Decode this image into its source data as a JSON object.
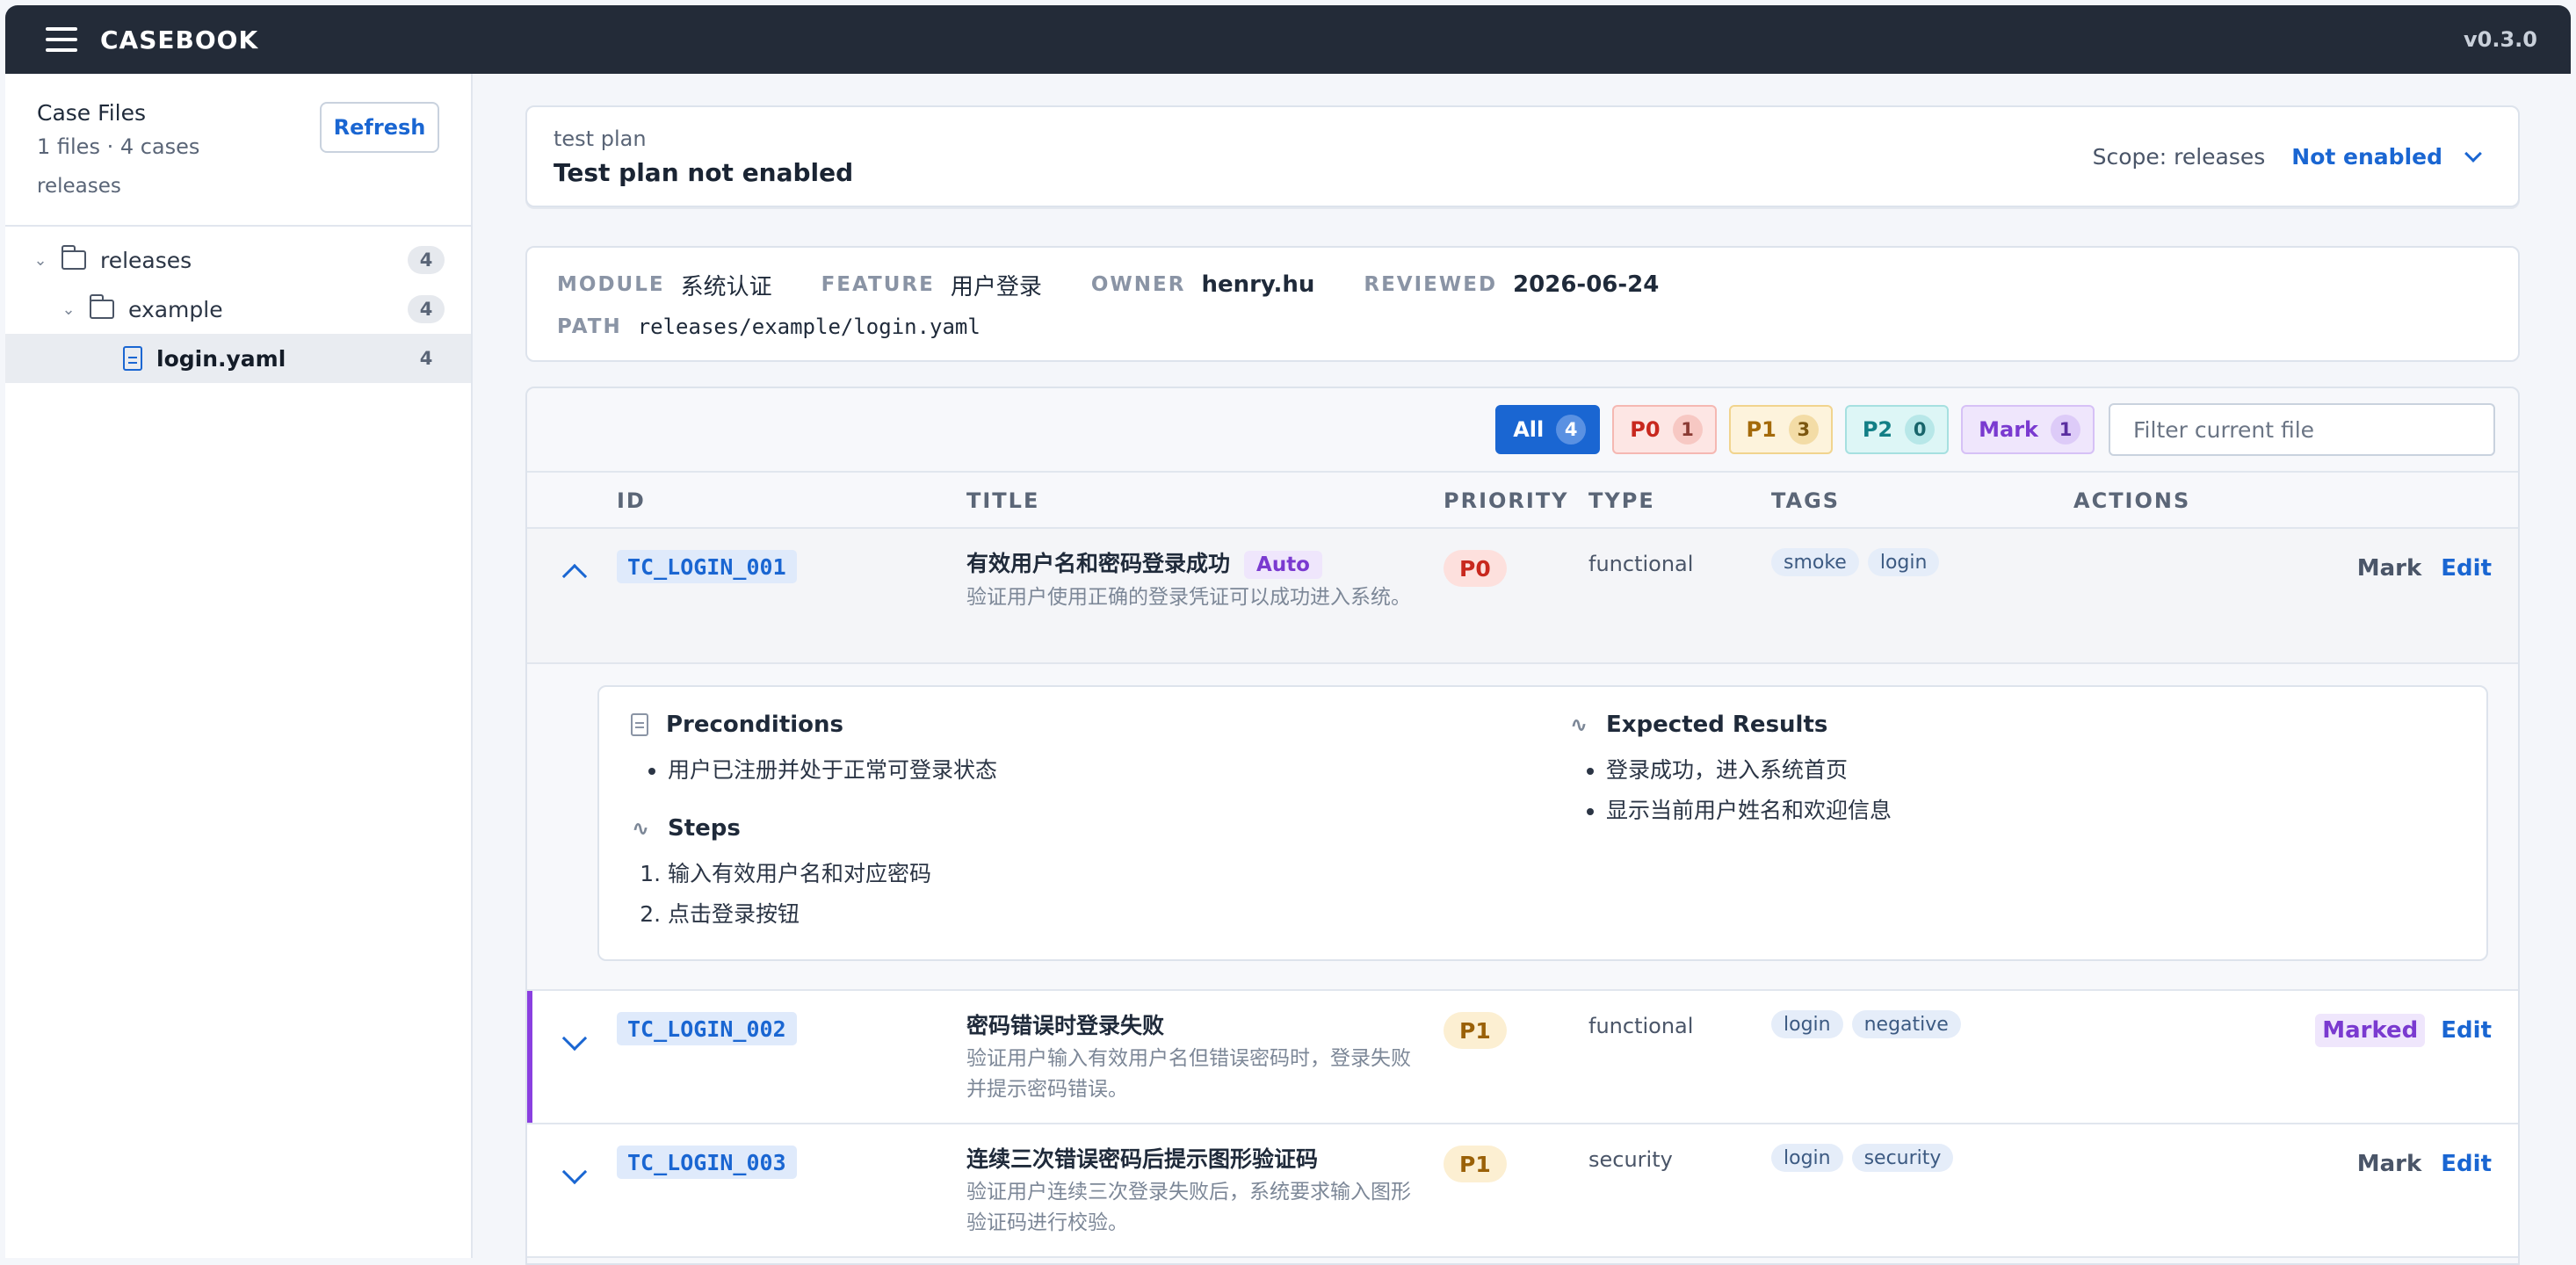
{
  "app": {
    "title": "CASEBOOK",
    "version": "v0.3.0"
  },
  "sidebar": {
    "title": "Case Files",
    "meta": "1 files · 4 cases",
    "scope": "releases",
    "refresh_label": "Refresh",
    "tree": [
      {
        "label": "releases",
        "count": "4",
        "kind": "folder"
      },
      {
        "label": "example",
        "count": "4",
        "kind": "folder"
      },
      {
        "label": "login.yaml",
        "count": "4",
        "kind": "file",
        "active": true
      }
    ]
  },
  "plan": {
    "label": "test plan",
    "title": "Test plan not enabled",
    "scope_text": "Scope: releases",
    "scope_value": "Not enabled"
  },
  "meta": {
    "module_key": "MODULE",
    "module_val": "系统认证",
    "feature_key": "FEATURE",
    "feature_val": "用户登录",
    "owner_key": "OWNER",
    "owner_val": "henry.hu",
    "reviewed_key": "REVIEWED",
    "reviewed_val": "2026-06-24",
    "path_key": "PATH",
    "path_val": "releases/example/login.yaml"
  },
  "filters": {
    "chips": [
      {
        "label": "All",
        "count": "4"
      },
      {
        "label": "P0",
        "count": "1"
      },
      {
        "label": "P1",
        "count": "3"
      },
      {
        "label": "P2",
        "count": "0"
      },
      {
        "label": "Mark",
        "count": "1"
      }
    ],
    "placeholder": "Filter current file"
  },
  "columns": {
    "id": "ID",
    "title": "TITLE",
    "priority": "PRIORITY",
    "type": "TYPE",
    "tags": "TAGS",
    "actions": "ACTIONS"
  },
  "cases": [
    {
      "id": "TC_LOGIN_001",
      "title": "有效用户名和密码登录成功",
      "badge": "Auto",
      "desc": "验证用户使用正确的登录凭证可以成功进入系统。",
      "priority": "P0",
      "type": "functional",
      "tags": [
        "smoke",
        "login"
      ],
      "mark_label": "Mark",
      "edit_label": "Edit"
    },
    {
      "id": "TC_LOGIN_002",
      "title": "密码错误时登录失败",
      "desc": "验证用户输入有效用户名但错误密码时，登录失败并提示密码错误。",
      "priority": "P1",
      "type": "functional",
      "tags": [
        "login",
        "negative"
      ],
      "mark_label": "Marked",
      "edit_label": "Edit"
    },
    {
      "id": "TC_LOGIN_003",
      "title": "连续三次错误密码后提示图形验证码",
      "desc": "验证用户连续三次登录失败后，系统要求输入图形验证码进行校验。",
      "priority": "P1",
      "type": "security",
      "tags": [
        "login",
        "security"
      ],
      "mark_label": "Mark",
      "edit_label": "Edit"
    }
  ],
  "detail": {
    "preconditions_title": "Preconditions",
    "preconditions": [
      "用户已注册并处于正常可登录状态"
    ],
    "steps_title": "Steps",
    "steps": [
      "输入有效用户名和对应密码",
      "点击登录按钮"
    ],
    "expected_title": "Expected Results",
    "expected": [
      "登录成功，进入系统首页",
      "显示当前用户姓名和欢迎信息"
    ]
  }
}
